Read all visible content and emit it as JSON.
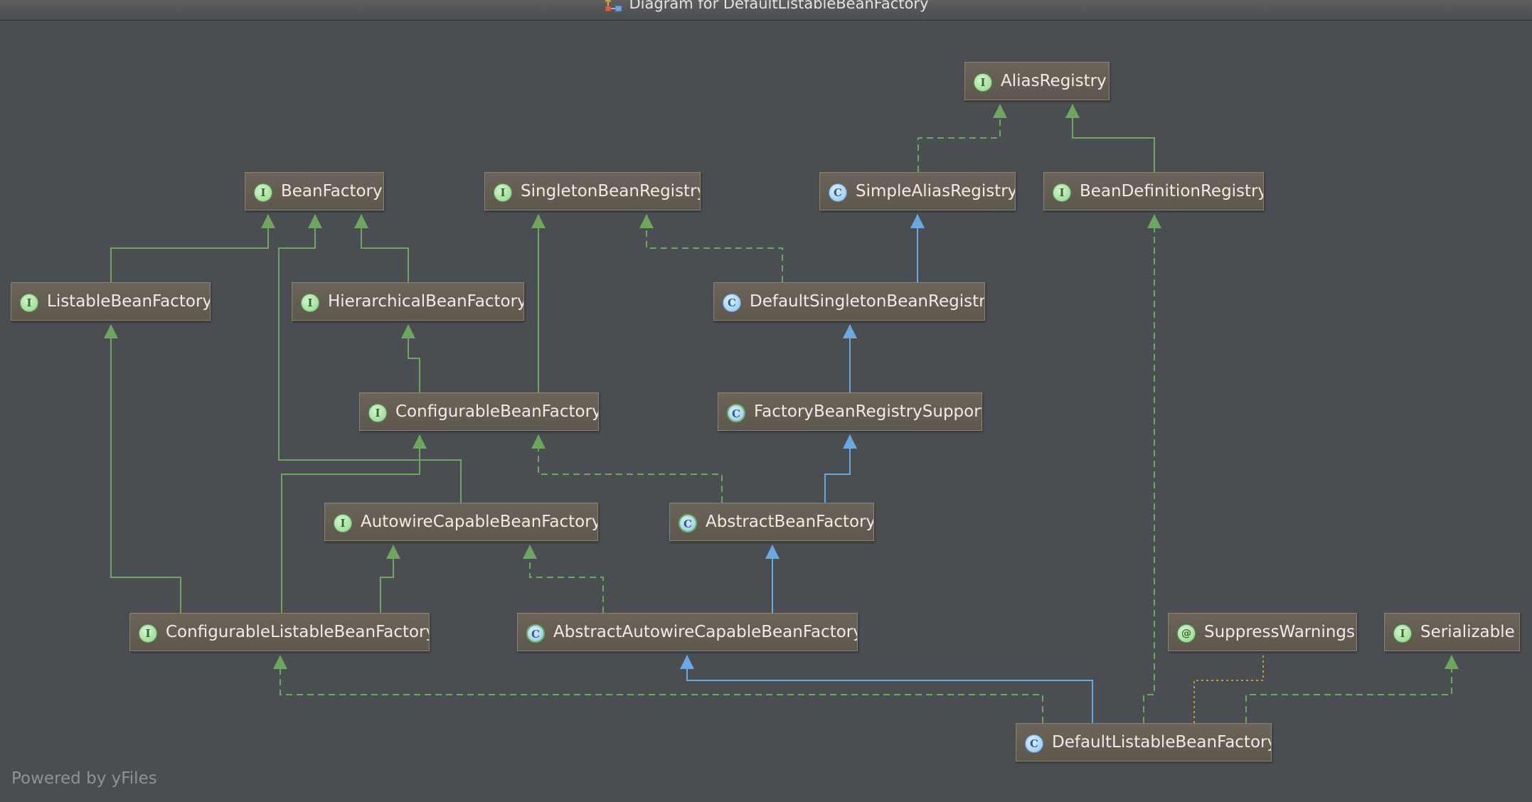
{
  "window": {
    "title": "Diagram for DefaultListableBeanFactory"
  },
  "footer": {
    "text": "Powered by yFiles"
  },
  "colors": {
    "background": "#4a4e52",
    "interface_edge": "#6ea55f",
    "class_edge": "#6aa8e2",
    "dependency_edge": "#b7a13a"
  },
  "nodes": [
    {
      "id": "AliasRegistry",
      "label": "AliasRegistry",
      "kind": "interface",
      "badge": "I"
    },
    {
      "id": "BeanFactory",
      "label": "BeanFactory",
      "kind": "interface",
      "badge": "I"
    },
    {
      "id": "SingletonBeanRegistry",
      "label": "SingletonBeanRegistry",
      "kind": "interface",
      "badge": "I"
    },
    {
      "id": "SimpleAliasRegistry",
      "label": "SimpleAliasRegistry",
      "kind": "class",
      "badge": "C"
    },
    {
      "id": "BeanDefinitionRegistry",
      "label": "BeanDefinitionRegistry",
      "kind": "interface",
      "badge": "I"
    },
    {
      "id": "ListableBeanFactory",
      "label": "ListableBeanFactory",
      "kind": "interface",
      "badge": "I"
    },
    {
      "id": "HierarchicalBeanFactory",
      "label": "HierarchicalBeanFactory",
      "kind": "interface",
      "badge": "I"
    },
    {
      "id": "DefaultSingletonBeanRegistry",
      "label": "DefaultSingletonBeanRegistry",
      "kind": "class",
      "badge": "C"
    },
    {
      "id": "ConfigurableBeanFactory",
      "label": "ConfigurableBeanFactory",
      "kind": "interface",
      "badge": "I"
    },
    {
      "id": "FactoryBeanRegistrySupport",
      "label": "FactoryBeanRegistrySupport",
      "kind": "abstract",
      "badge": "C"
    },
    {
      "id": "AutowireCapableBeanFactory",
      "label": "AutowireCapableBeanFactory",
      "kind": "interface",
      "badge": "I"
    },
    {
      "id": "AbstractBeanFactory",
      "label": "AbstractBeanFactory",
      "kind": "abstract",
      "badge": "C"
    },
    {
      "id": "ConfigurableListableBeanFactory",
      "label": "ConfigurableListableBeanFactory",
      "kind": "interface",
      "badge": "I"
    },
    {
      "id": "AbstractAutowireCapableBeanFactory",
      "label": "AbstractAutowireCapableBeanFactory",
      "kind": "abstract",
      "badge": "C"
    },
    {
      "id": "SuppressWarnings",
      "label": "SuppressWarnings",
      "kind": "annotation",
      "badge": "@"
    },
    {
      "id": "Serializable",
      "label": "Serializable",
      "kind": "interface",
      "badge": "I"
    },
    {
      "id": "DefaultListableBeanFactory",
      "label": "DefaultListableBeanFactory",
      "kind": "class",
      "badge": "C"
    }
  ],
  "edges": [
    {
      "from": "SimpleAliasRegistry",
      "to": "AliasRegistry",
      "type": "implements"
    },
    {
      "from": "BeanDefinitionRegistry",
      "to": "AliasRegistry",
      "type": "extends-interface"
    },
    {
      "from": "ListableBeanFactory",
      "to": "BeanFactory",
      "type": "extends-interface"
    },
    {
      "from": "AutowireCapableBeanFactory",
      "to": "BeanFactory",
      "type": "extends-interface"
    },
    {
      "from": "HierarchicalBeanFactory",
      "to": "BeanFactory",
      "type": "extends-interface"
    },
    {
      "from": "DefaultSingletonBeanRegistry",
      "to": "SingletonBeanRegistry",
      "type": "implements"
    },
    {
      "from": "DefaultSingletonBeanRegistry",
      "to": "SimpleAliasRegistry",
      "type": "extends-class"
    },
    {
      "from": "ConfigurableBeanFactory",
      "to": "HierarchicalBeanFactory",
      "type": "extends-interface"
    },
    {
      "from": "ConfigurableBeanFactory",
      "to": "SingletonBeanRegistry",
      "type": "extends-interface"
    },
    {
      "from": "FactoryBeanRegistrySupport",
      "to": "DefaultSingletonBeanRegistry",
      "type": "extends-class"
    },
    {
      "from": "AbstractBeanFactory",
      "to": "ConfigurableBeanFactory",
      "type": "implements"
    },
    {
      "from": "AbstractBeanFactory",
      "to": "FactoryBeanRegistrySupport",
      "type": "extends-class"
    },
    {
      "from": "ConfigurableListableBeanFactory",
      "to": "ListableBeanFactory",
      "type": "extends-interface"
    },
    {
      "from": "ConfigurableListableBeanFactory",
      "to": "ConfigurableBeanFactory",
      "type": "extends-interface"
    },
    {
      "from": "ConfigurableListableBeanFactory",
      "to": "AutowireCapableBeanFactory",
      "type": "extends-interface"
    },
    {
      "from": "AbstractAutowireCapableBeanFactory",
      "to": "AutowireCapableBeanFactory",
      "type": "implements"
    },
    {
      "from": "AbstractAutowireCapableBeanFactory",
      "to": "AbstractBeanFactory",
      "type": "extends-class"
    },
    {
      "from": "DefaultListableBeanFactory",
      "to": "AbstractAutowireCapableBeanFactory",
      "type": "extends-class"
    },
    {
      "from": "DefaultListableBeanFactory",
      "to": "ConfigurableListableBeanFactory",
      "type": "implements"
    },
    {
      "from": "DefaultListableBeanFactory",
      "to": "BeanDefinitionRegistry",
      "type": "implements"
    },
    {
      "from": "DefaultListableBeanFactory",
      "to": "Serializable",
      "type": "implements"
    },
    {
      "from": "DefaultListableBeanFactory",
      "to": "SuppressWarnings",
      "type": "annotated-with"
    }
  ]
}
